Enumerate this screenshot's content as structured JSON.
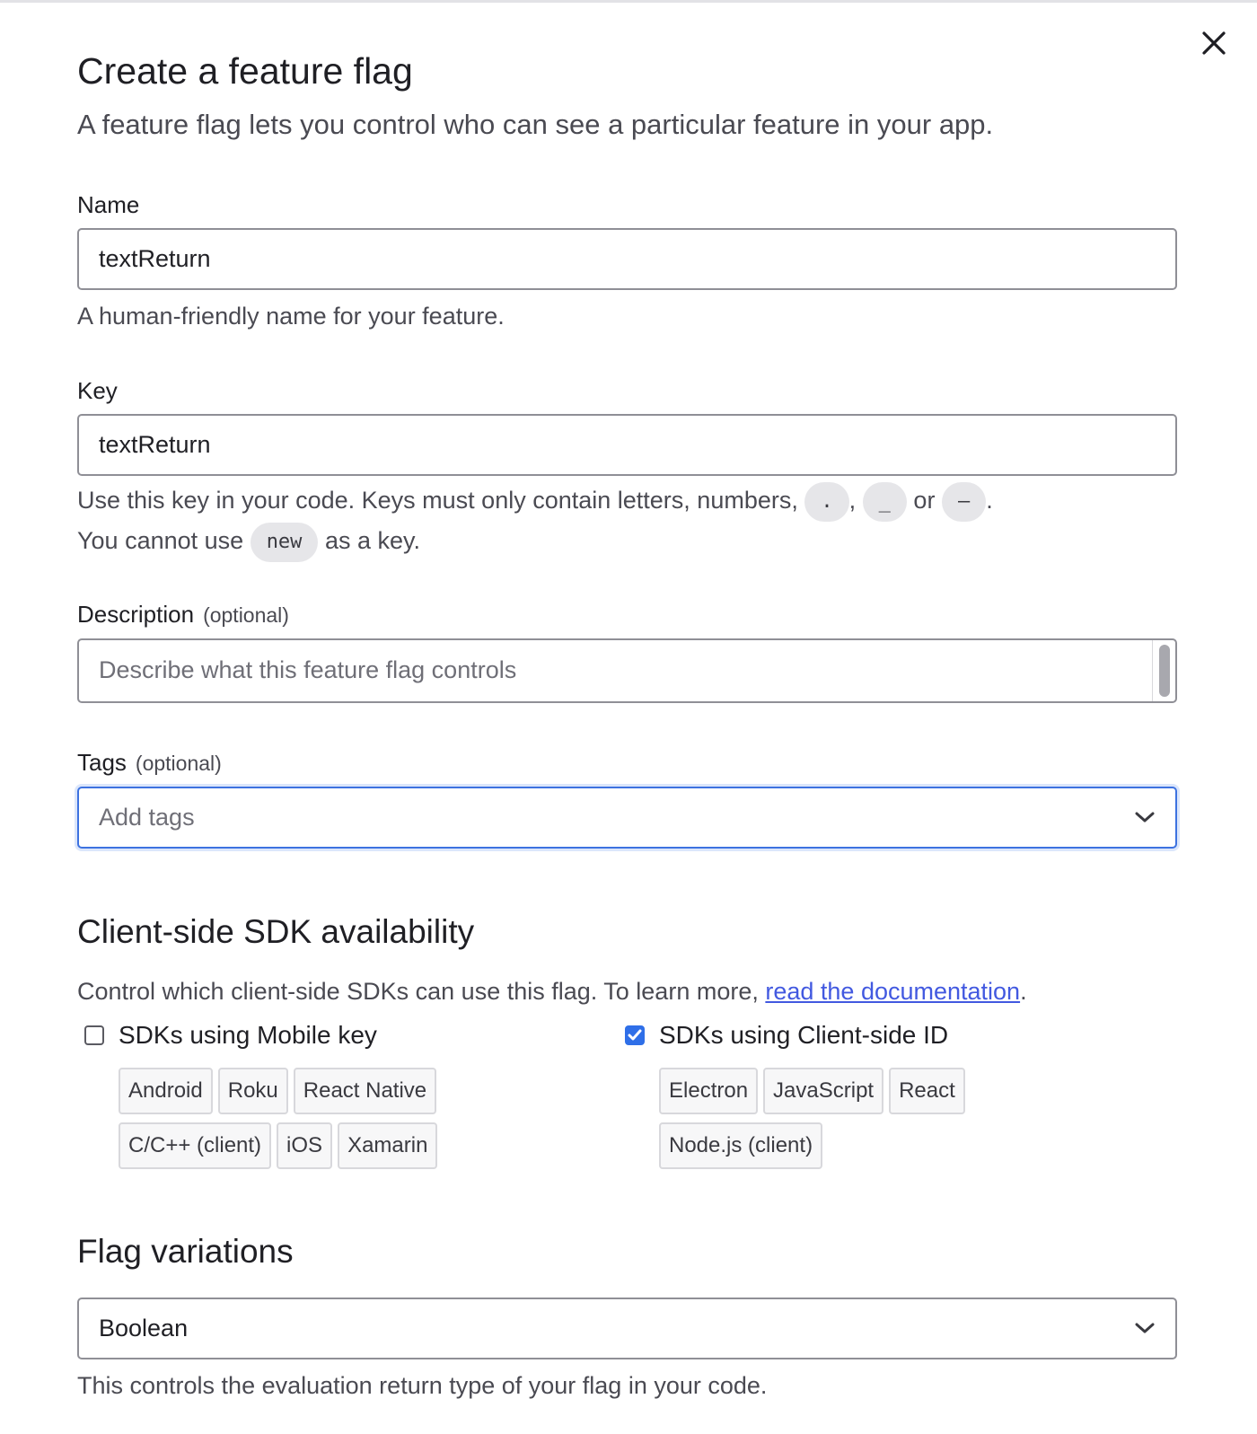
{
  "dialog": {
    "title": "Create a feature flag",
    "subtitle": "A feature flag lets you control who can see a particular feature in your app."
  },
  "name": {
    "label": "Name",
    "value": "textReturn",
    "help": "A human-friendly name for your feature."
  },
  "key": {
    "label": "Key",
    "value": "textReturn",
    "help_part1": "Use this key in your code. Keys must only contain letters, numbers,",
    "char_dot": ".",
    "sep_comma": ",",
    "char_underscore": "_",
    "sep_or": "or",
    "char_dash": "–",
    "period": ".",
    "help_part2": "You cannot use",
    "reserved_word": "new",
    "help_part3": "as a key."
  },
  "description": {
    "label": "Description",
    "optional": "(optional)",
    "placeholder": "Describe what this feature flag controls"
  },
  "tags": {
    "label": "Tags",
    "optional": "(optional)",
    "placeholder": "Add tags"
  },
  "sdk": {
    "heading": "Client-side SDK availability",
    "help": "Control which client-side SDKs can use this flag. To learn more,",
    "link_text": "read the documentation",
    "link_suffix": ".",
    "mobile": {
      "label": "SDKs using Mobile key",
      "checked": false,
      "chips": [
        "Android",
        "Roku",
        "React Native",
        "C/C++ (client)",
        "iOS",
        "Xamarin"
      ]
    },
    "client": {
      "label": "SDKs using Client-side ID",
      "checked": true,
      "chips": [
        "Electron",
        "JavaScript",
        "React",
        "Node.js (client)"
      ]
    }
  },
  "variations": {
    "heading": "Flag variations",
    "selected": "Boolean",
    "help": "This controls the evaluation return type of your flag in your code."
  },
  "icons": {
    "close": "close-icon",
    "chevron": "chevron-down-icon",
    "check": "checkmark-icon"
  },
  "colors": {
    "accent": "#2f6fe8",
    "link": "#4259e0",
    "focus_border": "#3d72e0"
  }
}
